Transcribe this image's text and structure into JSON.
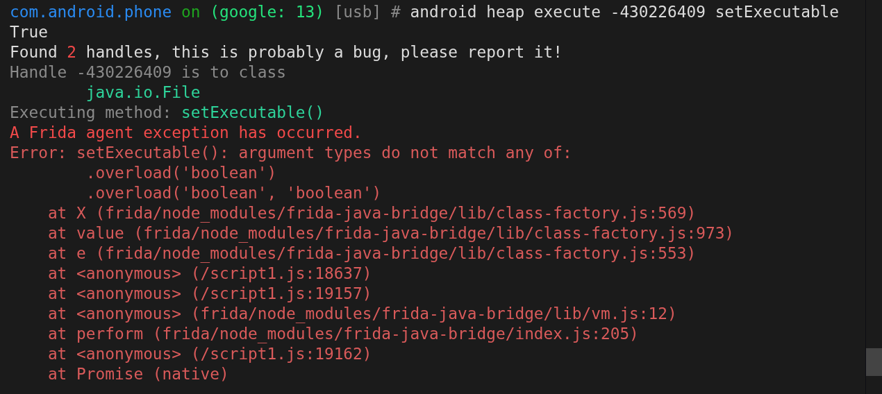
{
  "terminal": {
    "lines": [
      {
        "kind": "none",
        "segments": [
          {
            "kind": "device",
            "text": "com.android.phone"
          },
          {
            "kind": "on",
            "text": "on"
          },
          {
            "kind": "host",
            "text": "(google: 13)"
          },
          {
            "kind": "dim",
            "text": "[usb] #"
          },
          {
            "kind": "plain",
            "text": "android heap execute -430226409 setExecutable"
          }
        ]
      },
      {
        "kind": "none",
        "segments": [
          {
            "kind": "plain",
            "text": "True"
          }
        ]
      },
      {
        "kind": "none",
        "segments": [
          {
            "kind": "plain",
            "text": "Found"
          },
          {
            "kind": "count",
            "text": "2"
          },
          {
            "kind": "plain",
            "text": "handles, this is probably a bug, please report it!"
          }
        ]
      },
      {
        "kind": "none",
        "segments": [
          {
            "kind": "dim",
            "text": "Handle -430226409 is to class"
          }
        ]
      },
      {
        "kind": "tab",
        "segments": [
          {
            "kind": "accent",
            "text": "java.io.File"
          }
        ]
      },
      {
        "kind": "none",
        "segments": [
          {
            "kind": "dim",
            "text": "Executing method:"
          },
          {
            "kind": "accent",
            "text": "setExecutable()"
          }
        ]
      },
      {
        "kind": "none",
        "segments": [
          {
            "kind": "alert",
            "text": "A Frida agent exception has occurred."
          }
        ]
      },
      {
        "kind": "none",
        "segments": [
          {
            "kind": "error",
            "text": "Error: setExecutable(): argument types do not match any of:"
          }
        ]
      },
      {
        "kind": "tab",
        "segments": [
          {
            "kind": "error",
            "text": ".overload('boolean')"
          }
        ]
      },
      {
        "kind": "tab",
        "segments": [
          {
            "kind": "error",
            "text": ".overload('boolean', 'boolean')"
          }
        ]
      },
      {
        "kind": "stack",
        "segments": [
          {
            "kind": "error",
            "text": "at X (frida/node_modules/frida-java-bridge/lib/class-factory.js:569)"
          }
        ]
      },
      {
        "kind": "stack",
        "segments": [
          {
            "kind": "error",
            "text": "at value (frida/node_modules/frida-java-bridge/lib/class-factory.js:973)"
          }
        ]
      },
      {
        "kind": "stack",
        "segments": [
          {
            "kind": "error",
            "text": "at e (frida/node_modules/frida-java-bridge/lib/class-factory.js:553)"
          }
        ]
      },
      {
        "kind": "stack",
        "segments": [
          {
            "kind": "error",
            "text": "at <anonymous> (/script1.js:18637)"
          }
        ]
      },
      {
        "kind": "stack",
        "segments": [
          {
            "kind": "error",
            "text": "at <anonymous> (/script1.js:19157)"
          }
        ]
      },
      {
        "kind": "stack",
        "segments": [
          {
            "kind": "error",
            "text": "at <anonymous> (frida/node_modules/frida-java-bridge/lib/vm.js:12)"
          }
        ]
      },
      {
        "kind": "stack",
        "segments": [
          {
            "kind": "error",
            "text": "at perform (frida/node_modules/frida-java-bridge/index.js:205)"
          }
        ]
      },
      {
        "kind": "stack",
        "segments": [
          {
            "kind": "error",
            "text": "at <anonymous> (/script1.js:19162)"
          }
        ]
      },
      {
        "kind": "stack",
        "segments": [
          {
            "kind": "error",
            "text": "at Promise (native)"
          }
        ]
      }
    ]
  }
}
